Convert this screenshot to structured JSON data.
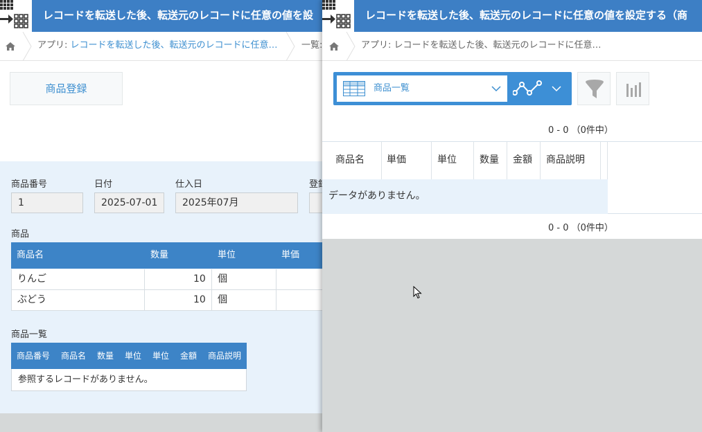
{
  "left": {
    "app_title": "レコードを転送した後、転送元のレコードに任意の値を設",
    "breadcrumb": {
      "app_prefix": "アプリ: ",
      "app_name": "レコードを転送した後、転送元のレコードに任意…",
      "next": "一覧:"
    },
    "register_button": "商品登録",
    "fields": {
      "product_no": {
        "label": "商品番号",
        "value": "1"
      },
      "date": {
        "label": "日付",
        "value": "2025-07-01"
      },
      "arrival": {
        "label": "仕入日",
        "value": "2025年07月"
      },
      "registered": {
        "label": "登録"
      }
    },
    "product_table": {
      "title": "商品",
      "headers": [
        "商品名",
        "数量",
        "単位",
        "単価"
      ],
      "rows": [
        {
          "name": "りんご",
          "qty": "10",
          "unit": "個"
        },
        {
          "name": "ぶどう",
          "qty": "10",
          "unit": "個"
        }
      ]
    },
    "reference_table": {
      "title": "商品一覧",
      "headers": [
        "商品番号",
        "商品名",
        "数量",
        "単位",
        "単位",
        "金額",
        "商品説明"
      ],
      "empty_text": "参照するレコードがありません。"
    }
  },
  "right": {
    "app_title": "レコードを転送した後、転送元のレコードに任意の値を設定する（商",
    "breadcrumb": {
      "app_prefix": "アプリ: ",
      "app_name": "レコードを転送した後、転送元のレコードに任意…"
    },
    "view_name": "商品一覧",
    "pager_top": "0 - 0 （0件中）",
    "pager_bottom": "0 - 0 （0件中）",
    "columns": [
      "商品名",
      "単価",
      "単位",
      "数量",
      "金額",
      "商品説明"
    ],
    "empty_text": "データがありません。"
  },
  "colors": {
    "header_blue": "#3d7fc5",
    "table_head_blue": "#3d84c7",
    "link_blue": "#3d8fd0",
    "form_bg": "#e8f2fb"
  }
}
